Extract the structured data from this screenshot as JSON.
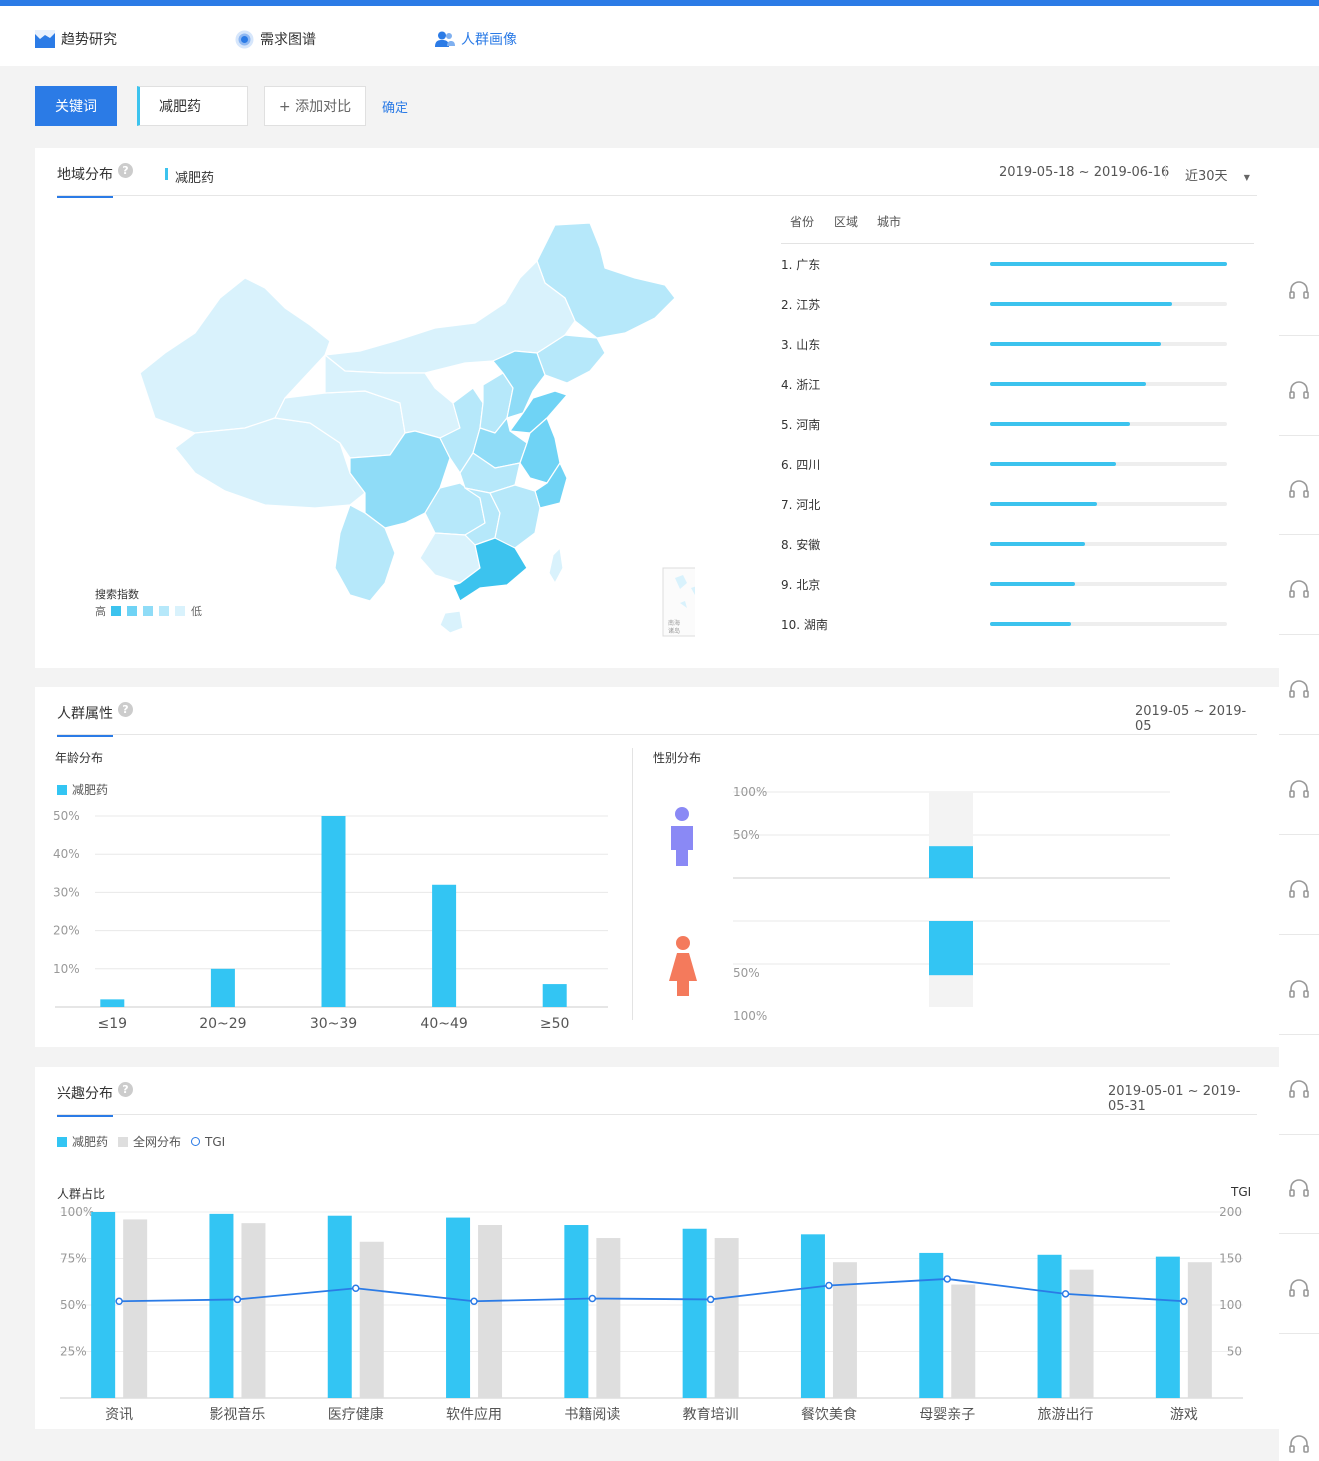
{
  "nav": {
    "trend": "趋势研究",
    "demand": "需求图谱",
    "crowd": "人群画像"
  },
  "search": {
    "keyword_button": "关键词",
    "keyword": "减肥药",
    "add_compare": "+ 添加对比",
    "confirm": "确定"
  },
  "region": {
    "title": "地域分布",
    "legend_keyword": "减肥药",
    "date_range": "2019-05-18 ~ 2019-06-16",
    "period": "近30天",
    "tabs": [
      "省份",
      "区域",
      "城市"
    ],
    "map_legend_title": "搜索指数",
    "map_legend_high": "高",
    "map_legend_low": "低",
    "inset_label_1": "南海",
    "inset_label_2": "诸岛",
    "ranking": [
      {
        "label": "1.  广东",
        "value": 1.0
      },
      {
        "label": "2.  江苏",
        "value": 0.77
      },
      {
        "label": "3.  山东",
        "value": 0.72
      },
      {
        "label": "4.  浙江",
        "value": 0.66
      },
      {
        "label": "5.  河南",
        "value": 0.59
      },
      {
        "label": "6.  四川",
        "value": 0.53
      },
      {
        "label": "7.  河北",
        "value": 0.45
      },
      {
        "label": "8.  安徽",
        "value": 0.4
      },
      {
        "label": "9.  北京",
        "value": 0.36
      },
      {
        "label": "10. 湖南",
        "value": 0.34
      }
    ],
    "colors": {
      "darkest": "#3cc3ee",
      "dark": "#6fd3f5",
      "mid": "#8fdcf7",
      "light": "#b6e8fa",
      "lightest": "#d9f2fc"
    }
  },
  "crowd": {
    "title": "人群属性",
    "date_range": "2019-05 ~ 2019-05",
    "age_title": "年龄分布",
    "age_legend": "减肥药",
    "gender_title": "性别分布",
    "gender_ticks_top": [
      "100%",
      "50%"
    ],
    "gender_ticks_bottom": [
      "50%",
      "100%"
    ]
  },
  "interest": {
    "title": "兴趣分布",
    "date_range": "2019-05-01 ~ 2019-05-31",
    "legend": [
      "减肥药",
      "全网分布",
      "TGI"
    ],
    "left_axis_title": "人群占比",
    "right_axis_title": "TGI"
  },
  "chart_data": [
    {
      "type": "bar",
      "categories": [
        "≤19",
        "20~29",
        "30~39",
        "40~49",
        "≥50"
      ],
      "series": [
        {
          "name": "减肥药",
          "values": [
            2,
            10,
            50,
            32,
            6
          ]
        }
      ],
      "yticks": [
        "50%",
        "40%",
        "30%",
        "20%",
        "10%"
      ],
      "ylim": [
        0,
        50
      ],
      "grid": true,
      "legend": "top-left",
      "color": "#33c5f3"
    },
    {
      "type": "bar",
      "categories": [
        "男",
        "女"
      ],
      "values": [
        37,
        63
      ],
      "ylim": [
        0,
        100
      ],
      "color": "#33c5f3"
    },
    {
      "type": "bar",
      "categories": [
        "资讯",
        "影视音乐",
        "医疗健康",
        "软件应用",
        "书籍阅读",
        "教育培训",
        "餐饮美食",
        "母婴亲子",
        "旅游出行",
        "游戏"
      ],
      "series": [
        {
          "name": "减肥药",
          "values": [
            100,
            99,
            98,
            97,
            93,
            91,
            88,
            78,
            77,
            76
          ]
        },
        {
          "name": "全网分布",
          "values": [
            96,
            94,
            84,
            93,
            86,
            86,
            73,
            61,
            69,
            73
          ]
        },
        {
          "name": "TGI",
          "axis": "right",
          "values": [
            104,
            106,
            118,
            104,
            107,
            106,
            121,
            128,
            112,
            104
          ]
        }
      ],
      "ylim": [
        0,
        100
      ],
      "y2lim": [
        0,
        200
      ],
      "yticks": [
        "100%",
        "75%",
        "50%",
        "25%"
      ],
      "y2ticks": [
        "200",
        "150",
        "100",
        "50"
      ],
      "grid": true,
      "legend": "top-left",
      "colors": {
        "main": "#33c5f3",
        "overall": "#dedede",
        "tgi": "#2b7be6"
      }
    }
  ]
}
